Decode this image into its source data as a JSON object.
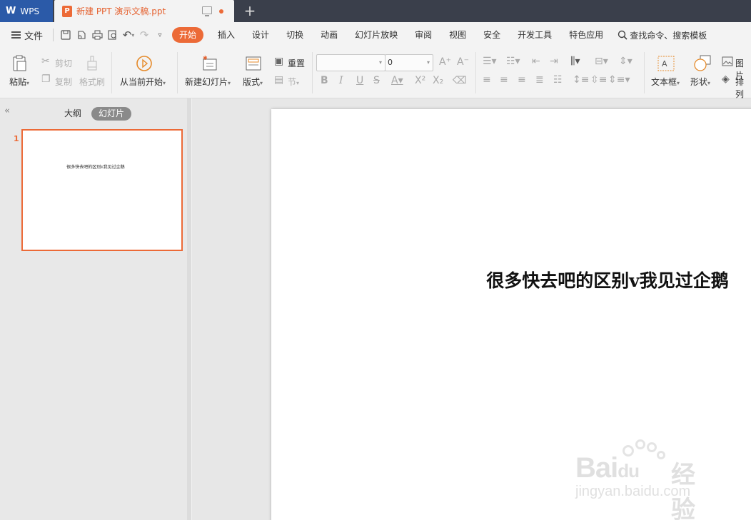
{
  "titlebar": {
    "app_name": "WPS",
    "doc_tab_title": "新建 PPT 演示文稿.ppt",
    "new_tab": "+"
  },
  "menubar": {
    "file_label": "文件",
    "tabs": [
      "开始",
      "插入",
      "设计",
      "切换",
      "动画",
      "幻灯片放映",
      "审阅",
      "视图",
      "安全",
      "开发工具",
      "特色应用"
    ],
    "active_tab": "开始",
    "search_label": "查找命令、搜索模板"
  },
  "ribbon": {
    "paste": "粘贴",
    "cut": "剪切",
    "copy": "复制",
    "format_painter": "格式刷",
    "play_from_current": "从当前开始",
    "new_slide": "新建幻灯片",
    "layout": "版式",
    "reset": "重置",
    "section": "节",
    "font_name": "",
    "font_size": "0",
    "text_box": "文本框",
    "shape": "形状",
    "picture": "图片",
    "arrange": "排列"
  },
  "left_pane": {
    "tab_outline": "大纲",
    "tab_slides": "幻灯片",
    "slide_number": "1",
    "thumb_text": "很多快去吧的区别v我见过企鹅"
  },
  "slide": {
    "title": "很多快去吧的区别v我见过企鹅"
  },
  "watermark": {
    "brand": "Bai",
    "brand2": "du",
    "jingyan": "经验",
    "url": "jingyan.baidu.com"
  },
  "colors": {
    "accent": "#ec6a37",
    "titlebar": "#3a3f4b",
    "app_tab": "#2b5aa8"
  }
}
